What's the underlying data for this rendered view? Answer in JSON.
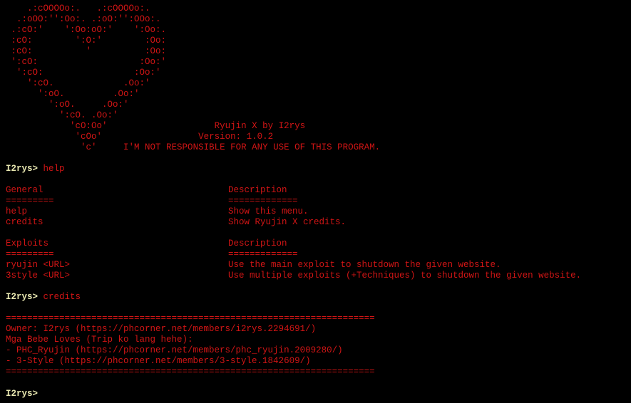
{
  "colors": {
    "background": "#000000",
    "text": "#d11515",
    "prompt": "#e8e7b0"
  },
  "banner": {
    "art": [
      "    .:cOOOOo:.   .:cOOOOo:.",
      "  .:oOO:'':Oo:. .:oO:'':OOo:.",
      " .:cO:'    ':Oo:oO:'    ':Oo:.",
      " :cO:        ':O:'        :Oo:",
      " :cO:          '          :Oo:",
      " ':cO:                   :Oo:'",
      "  ':cO:                 :Oo:'",
      "    ':cO.             .Oo:'",
      "      ':oO.         .Oo:'",
      "        ':oO.     .Oo:'",
      "          ':cO. .Oo:'"
    ],
    "art_tail": [
      "            'cO:Oo'",
      "             'cOo'",
      "              'c'"
    ],
    "title": "Ryujin X by I2rys",
    "version": "Version: 1.0.2",
    "disclaimer": "I'M NOT RESPONSIBLE FOR ANY USE OF THIS PROGRAM."
  },
  "prompt": "I2rys>",
  "session1": {
    "command": "help",
    "general": {
      "header_left": "General",
      "header_right": "Description",
      "rule_left": "=========",
      "rule_right": "=============",
      "rows": [
        {
          "name": "help",
          "desc": "Show this menu."
        },
        {
          "name": "credits",
          "desc": "Show Ryujin X credits."
        }
      ]
    },
    "exploits": {
      "header_left": "Exploits",
      "header_right": "Description",
      "rule_left": "=========",
      "rule_right": "=============",
      "rows": [
        {
          "name": "ryujin <URL>",
          "desc": "Use the main exploit to shutdown the given website."
        },
        {
          "name": "3style <URL>",
          "desc": "Use multiple exploits (+Techniques) to shutdown the given website."
        }
      ]
    }
  },
  "session2": {
    "command": "credits",
    "rule": "=====================================================================",
    "lines": [
      "Owner: I2rys (https://phcorner.net/members/i2rys.2294691/)",
      "Mga Bebe Loves (Trip ko lang hehe):",
      "- PHC_Ryujin (https://phcorner.net/members/phc_ryujin.2009280/)",
      "- 3-Style (https://phcorner.net/members/3-style.1842609/)"
    ]
  }
}
